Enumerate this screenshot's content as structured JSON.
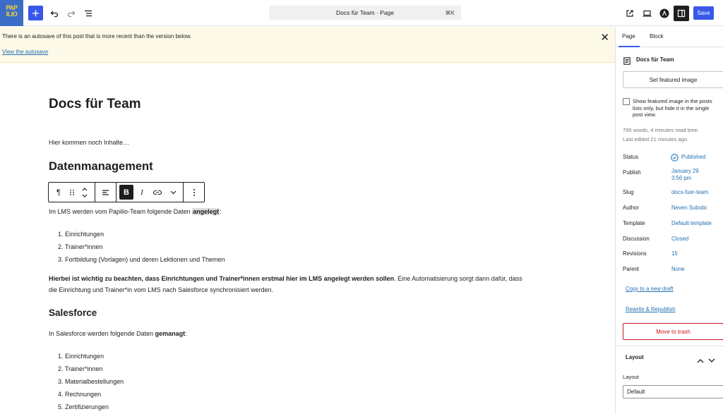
{
  "topbar": {
    "logo_text": "PAP ILIO",
    "add_label": "+",
    "command": "Docs für Team · Page",
    "shortcut": "⌘K",
    "save_label": "Save"
  },
  "notice": {
    "message": "There is an autosave of this post that is more recent than the version below.",
    "link": "View the autosave"
  },
  "content": {
    "title": "Docs für Team",
    "intro": "Hier kommen noch Inhalte…",
    "h_datenmanagement": "Datenmanagement",
    "para1_pre": "Im LMS werden vom Papilio-Team folgende Daten ",
    "para1_hl": "angelegt",
    "para1_post": ":",
    "list1": [
      "Einrichtungen",
      "Trainer*innen",
      "Fortbildung (Vorlagen) und deren Lektionen und Themen"
    ],
    "list1_nums": [
      "1.",
      "2.",
      "3."
    ],
    "para2_bold": "Hierbei ist wichtig zu beachten, dass Einrichtungen und Trainer*innen erstmal hier im LMS angelegt werden sollen",
    "para2_rest": ". Eine Automatisierung sorgt dann dafür, dass",
    "para2_line2": "die Einrichtung und Trainer*in vom LMS nach Salesforce synchronisiert werden.",
    "h_salesforce": "Salesforce",
    "para3_pre": "In Salesforce werden folgende Daten ",
    "para3_bold": "gemanagt",
    "para3_post": ":",
    "list2": [
      "Einrichtungen",
      "Trainer*innen",
      "Materialbestellungen",
      "Rechnungen",
      "Zertifizierungen"
    ],
    "list2_nums": [
      "1.",
      "2.",
      "3.",
      "4.",
      "5."
    ]
  },
  "toolbar": {
    "paragraph_icon": "¶",
    "bold": "B",
    "italic": "I"
  },
  "sidebar": {
    "tab_page": "Page",
    "tab_block": "Block",
    "doc_title": "Docs für Team",
    "featured_button": "Set featured image",
    "checkbox_label": "Show featured image in the posts lists only, but hide it in the single post view.",
    "words": "795 words, 4 minutes read time.",
    "last_edited": "Last edited 21 minutes ago.",
    "rows": {
      "status_label": "Status",
      "status_value": "Published",
      "publish_label": "Publish",
      "publish_value1": "January 29",
      "publish_value2": "3:56 pm",
      "slug_label": "Slug",
      "slug_value": "docs-fuer-team",
      "author_label": "Author",
      "author_value": "Neven Subotic",
      "template_label": "Template",
      "template_value": "Default template",
      "discussion_label": "Discussion",
      "discussion_value": "Closed",
      "revisions_label": "Revisions",
      "revisions_value": "15",
      "parent_label": "Parent",
      "parent_value": "None"
    },
    "copy_draft": "Copy to a new draft",
    "rewrite": "Rewrite & Republish",
    "trash": "Move to trash",
    "layout_panel": "Layout",
    "layout_label": "Layout",
    "layout_value": "Default"
  },
  "colors": {
    "accent": "#3858e9",
    "link": "#2271b1",
    "danger": "#cc1818",
    "notice_bg": "#fcf9e8"
  }
}
